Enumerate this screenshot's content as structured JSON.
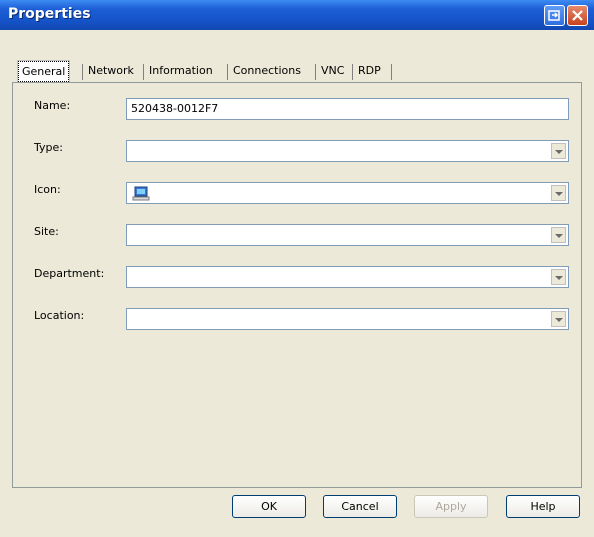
{
  "window": {
    "title": "Properties"
  },
  "tabs": [
    "General",
    "Network",
    "Information",
    "Connections",
    "VNC",
    "RDP"
  ],
  "form": {
    "name_label": "Name:",
    "name_value": "520438-0012F7",
    "type_label": "Type:",
    "type_value": "",
    "icon_label": "Icon:",
    "icon_value": "computer-icon",
    "site_label": "Site:",
    "site_value": "",
    "department_label": "Department:",
    "department_value": "",
    "location_label": "Location:",
    "location_value": ""
  },
  "buttons": {
    "ok": "OK",
    "cancel": "Cancel",
    "apply": "Apply",
    "help": "Help"
  }
}
